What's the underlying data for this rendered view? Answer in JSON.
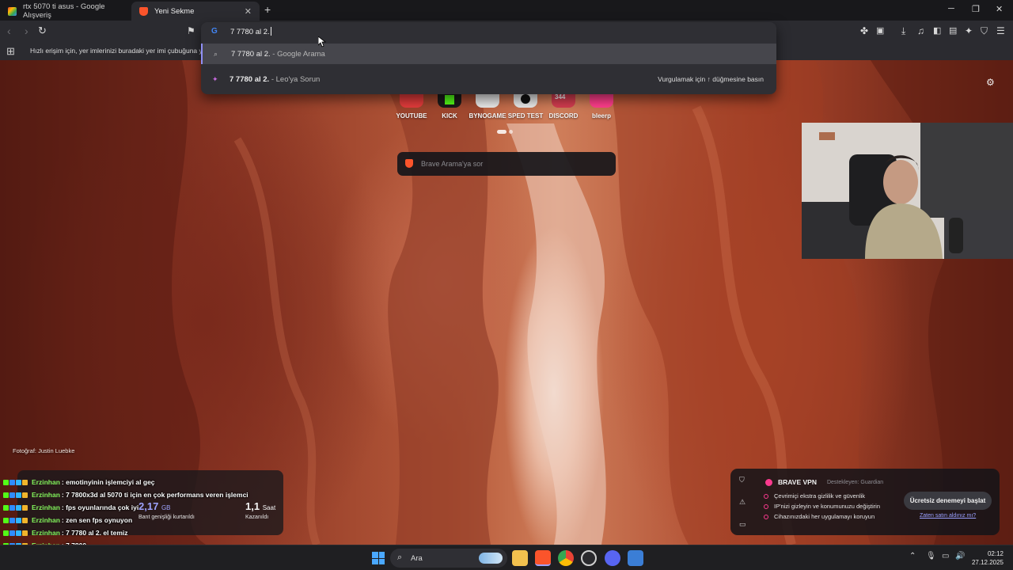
{
  "tabs": [
    {
      "title": "rtx 5070 ti asus - Google Alışveriş",
      "active": false
    },
    {
      "title": "Yeni Sekme",
      "active": true
    }
  ],
  "omnibox": {
    "value": "7 7780 al 2.",
    "suggestions": [
      {
        "bold": "7 7780 al 2.",
        "suffix": " - Google Arama",
        "icon": "search-icon"
      },
      {
        "bold": "7 7780 al 2.",
        "suffix": " - Leo'ya Sorun",
        "icon": "leo-icon",
        "hint": "Vurgulamak için ↑ düğmesine basın"
      }
    ]
  },
  "bookmarks_bar": {
    "hint": "Hızlı erişim için, yer imlerinizi buradaki yer imi çubuğuna yerleştirin."
  },
  "top_sites": [
    {
      "label": "YOUTUBE",
      "color": "#e23b3b"
    },
    {
      "label": "KICK",
      "color": "#53fc18"
    },
    {
      "label": "BYNOGAME",
      "color": "#222222"
    },
    {
      "label": "SPED TEST",
      "color": "#111111"
    },
    {
      "label": "DISCORD",
      "color": "#d23c4f",
      "badge": "344"
    },
    {
      "label": "bleerp",
      "color": "#ff3d8b"
    }
  ],
  "search": {
    "placeholder": "Brave Arama'ya sor"
  },
  "photo_credit": "Fotoğraf: Justin Luebke",
  "stats": {
    "bandwidth_value": "2,17",
    "bandwidth_unit": "GB",
    "bandwidth_label": "Bant genişliği kurtarıldı",
    "time_value": "1,1",
    "time_unit": "Saat",
    "time_label": "Kazanıldı"
  },
  "chat": [
    {
      "user": "Erzinhan",
      "text": " : emotinyinin işlemciyi al geç"
    },
    {
      "user": "Erzinhan",
      "text": " : 7 7800x3d al 5070 ti için en çok performans veren işlemci"
    },
    {
      "user": "Erzinhan",
      "text": " : fps oyunlarında çok iyi"
    },
    {
      "user": "Erzinhan",
      "text": " : zen sen fps oynuyon"
    },
    {
      "user": "Erzinhan",
      "text": " : 7 7780 al 2. el temiz"
    },
    {
      "user": "Erzinhan",
      "text": " : 7 7800"
    }
  ],
  "vpn": {
    "title": "BRAVE VPN",
    "supported_by": "Destekleyen: Guardian",
    "features": [
      "Çevrimiçi ekstra gizlilik ve güvenlik",
      "IP'nizi gizleyin ve konumunuzu değiştirin",
      "Cihazınızdaki her uygulamayı koruyun"
    ],
    "cta": "Ücretsiz denemeyi başlat",
    "link": "Zaten satın aldınız mı?"
  },
  "taskbar": {
    "search_label": "Ara",
    "time": "02:12",
    "date": "27.12.2025"
  },
  "colors": {
    "accent": "#9ea3ff",
    "brave": "#fb542b",
    "vpn": "#fb3a8e",
    "chat_user": "#82f55c"
  }
}
